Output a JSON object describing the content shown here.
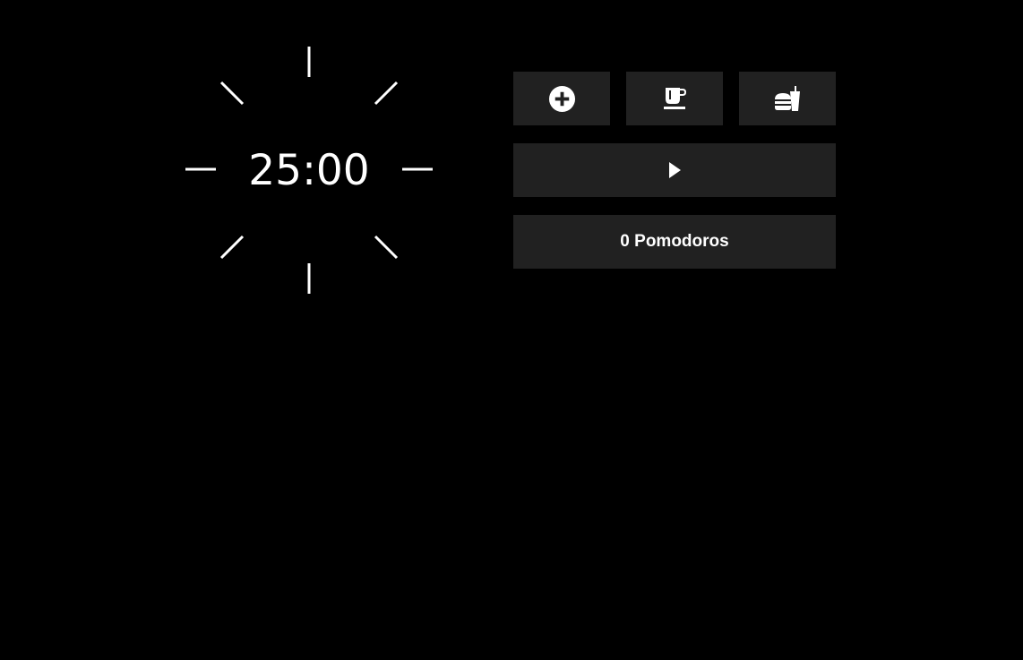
{
  "timer": {
    "display": "25:00"
  },
  "controls": {
    "modes": [
      {
        "icon": "plus-circle-icon"
      },
      {
        "icon": "coffee-cup-icon"
      },
      {
        "icon": "burger-drink-icon"
      }
    ],
    "play": {
      "icon": "play-icon"
    },
    "pomodoro_count_label": "0 Pomodoros"
  },
  "colors": {
    "background": "#000000",
    "button_background": "#212121",
    "foreground": "#ffffff"
  }
}
